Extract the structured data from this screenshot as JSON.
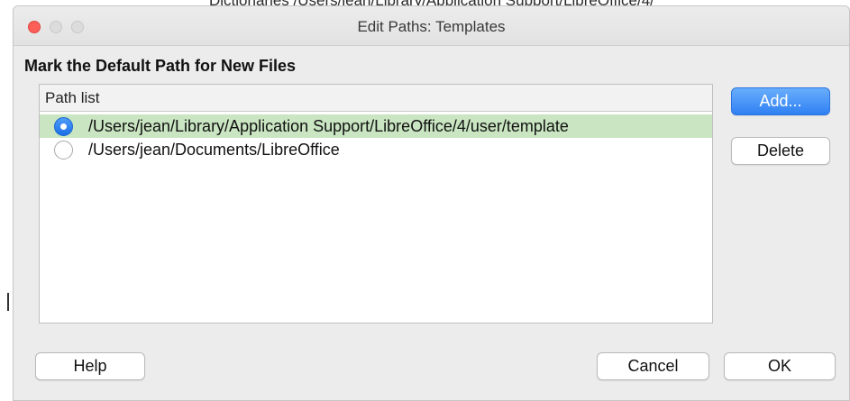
{
  "background": {
    "partial_text": "Dictionaries    /Users/jean/Library/Application Support/LibreOffice/4/"
  },
  "window": {
    "title": "Edit Paths: Templates"
  },
  "section": {
    "heading": "Mark the Default Path for New Files"
  },
  "path_list": {
    "header": "Path list",
    "items": [
      {
        "path": "/Users/jean/Library/Application Support/LibreOffice/4/user/template",
        "selected": true
      },
      {
        "path": "/Users/jean/Documents/LibreOffice",
        "selected": false
      }
    ]
  },
  "buttons": {
    "add": "Add...",
    "delete": "Delete",
    "help": "Help",
    "cancel": "Cancel",
    "ok": "OK"
  },
  "colors": {
    "selected_row": "#c9e5c1",
    "primary_button": "#2f80f3",
    "close_button": "#fc5f57"
  },
  "icons": {
    "window_controls": [
      "close-icon",
      "minimize-icon",
      "zoom-icon"
    ],
    "radio_selected": "radio-checked-icon",
    "radio_unselected": "radio-unchecked-icon"
  }
}
